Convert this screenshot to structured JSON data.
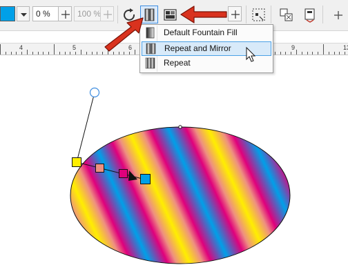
{
  "toolbar": {
    "fill_color": "#00a0e8",
    "opacity_value": "0 %",
    "midpoint_value": "100 %",
    "buttons": [
      "reverse-icon",
      "repeat-mirror-icon",
      "fill-layout-icon",
      "node-tool-icon",
      "copy-fill-icon",
      "edit-fill-icon",
      "add-icon"
    ]
  },
  "ruler": {
    "labels": [
      "4",
      "5",
      "6",
      "9",
      "13"
    ]
  },
  "dropdown": {
    "items": [
      {
        "label": "Default Fountain Fill",
        "icon": "linear-fill-icon"
      },
      {
        "label": "Repeat and Mirror",
        "icon": "repeat-mirror-fill-icon",
        "hovered": true
      },
      {
        "label": "Repeat",
        "icon": "repeat-fill-icon"
      }
    ]
  },
  "gradient": {
    "stops_colors": [
      "#ffee00",
      "#ee9080",
      "#e0007c",
      "#00a0e8"
    ],
    "highlight_color": "#e0007c",
    "annotation_color": "#d9321e"
  }
}
